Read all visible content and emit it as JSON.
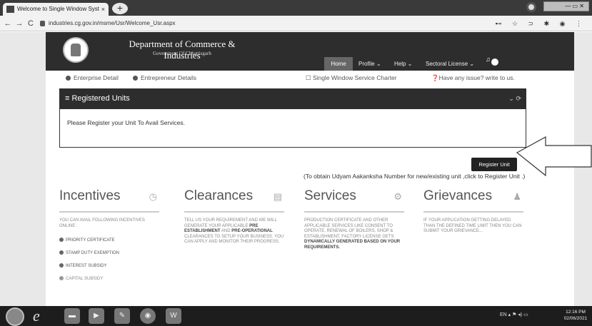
{
  "browser": {
    "tab_title": "Welcome to Single Window Syst",
    "tab_close": "×",
    "new_tab": "+",
    "url": "industries.cg.gov.in/msme/Usr/Welcome_Usr.aspx",
    "back": "←",
    "forward": "→",
    "reload": "C",
    "toolbar_icons": "⊷ ☆ ⊃ ✱ ◉ ⋮"
  },
  "header": {
    "dept_title": "Department of Commerce & Industries",
    "govt_subtitle": "Government Of Chhattisgarh",
    "nav": [
      {
        "label": "Home"
      },
      {
        "label": "Profile ⌄"
      },
      {
        "label": "Help ⌄"
      },
      {
        "label": "Sectoral License ⌄"
      }
    ]
  },
  "subnav": {
    "enterprise": "Enterprise Detail",
    "entrepreneur": "Entrepreneur Details",
    "charter": "Single Window Service Charter",
    "issue": "Have any issue? write to us."
  },
  "panel": {
    "title": "≡ Registered Units",
    "controls": "⌄ ⟳",
    "message": "Please Register your Unit To Avail Services."
  },
  "register": {
    "button": "Register Unit",
    "note": "(To obtain Udyam Aakanksha Number for new/existing unit ,click to Register Unit .)"
  },
  "cards": [
    {
      "title": "Incentives",
      "desc": "You can avail following incentives online :",
      "items": [
        "Priority Certificate",
        "Stamp Duty Exemption",
        "Interest Subsidy",
        "Capital Subsidy"
      ]
    },
    {
      "title": "Clearances",
      "desc_a": "Tell us your requirement and we will generate your applicable ",
      "desc_b": "Pre Establishment",
      "desc_c": " and ",
      "desc_d": "Pre-Operational",
      "desc_e": " clearances to setup your business. You can apply and monitor their progress."
    },
    {
      "title": "Services",
      "desc_a": "Production certificate and other applicable services like consent to operate, renewal of boilers, shop & establishment, factory license gets ",
      "desc_b": "dynamically generated based on your requirements."
    },
    {
      "title": "Grievances",
      "desc": "If your application getting delayed than the defined time limit then you can submit your grievance..."
    }
  ],
  "taskbar": {
    "tray": "EN  ▴  ⚑  ◂)  ▭",
    "time": "12:16 PM",
    "date": "02/06/2021"
  }
}
